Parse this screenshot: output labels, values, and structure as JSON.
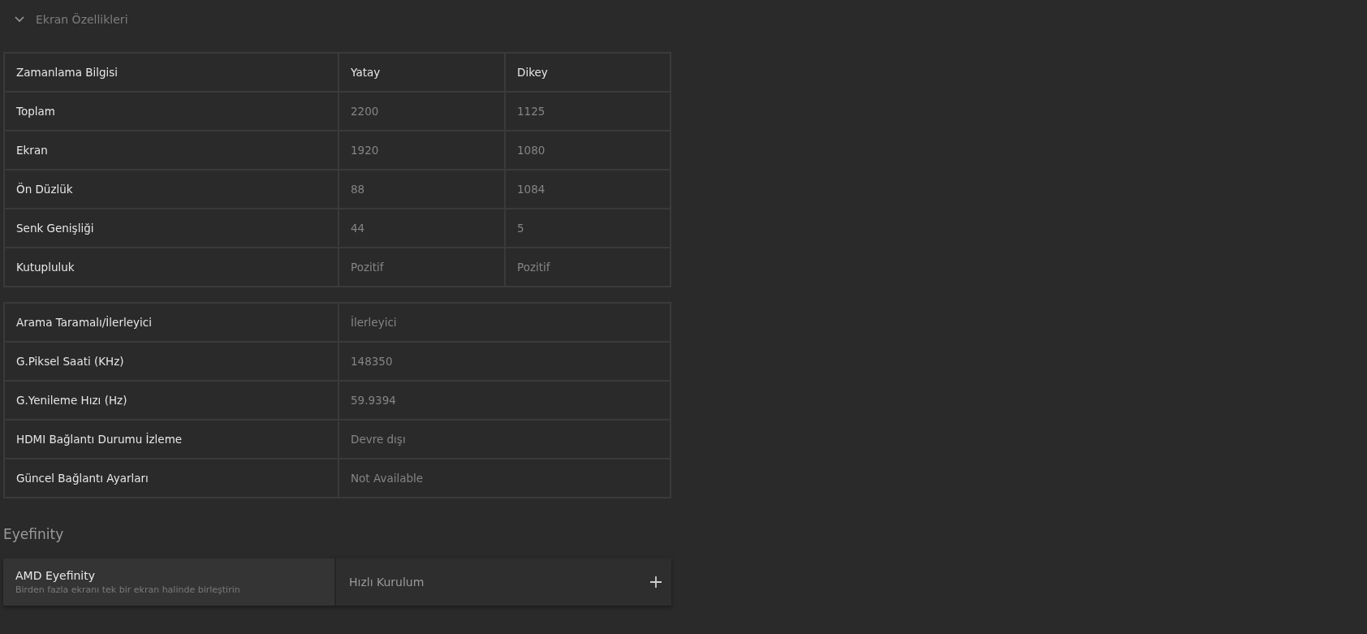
{
  "section": {
    "title": "Ekran Özellikleri",
    "expanded": true
  },
  "timing_table": {
    "columns": [
      "Zamanlama Bilgisi",
      "Yatay",
      "Dikey"
    ],
    "rows": [
      {
        "label": "Toplam",
        "horizontal": "2200",
        "vertical": "1125"
      },
      {
        "label": "Ekran",
        "horizontal": "1920",
        "vertical": "1080"
      },
      {
        "label": "Ön Düzlük",
        "horizontal": "88",
        "vertical": "1084"
      },
      {
        "label": "Senk Genişliği",
        "horizontal": "44",
        "vertical": "5"
      },
      {
        "label": "Kutupluluk",
        "horizontal": "Pozitif",
        "vertical": "Pozitif"
      }
    ]
  },
  "info_table": {
    "rows": [
      {
        "label": "Arama Taramalı/İlerleyici",
        "value": "İlerleyici"
      },
      {
        "label": "G.Piksel Saati (KHz)",
        "value": "148350"
      },
      {
        "label": "G.Yenileme Hızı (Hz)",
        "value": "59.9394"
      },
      {
        "label": "HDMI Bağlantı Durumu İzleme",
        "value": "Devre dışı"
      },
      {
        "label": "Güncel Bağlantı Ayarları",
        "value": "Not Available"
      }
    ]
  },
  "eyefinity": {
    "heading": "Eyefinity",
    "title": "AMD Eyefinity",
    "description": "Birden fazla ekranı tek bir ekran halinde birleştirin",
    "action": "Hızlı Kurulum"
  }
}
